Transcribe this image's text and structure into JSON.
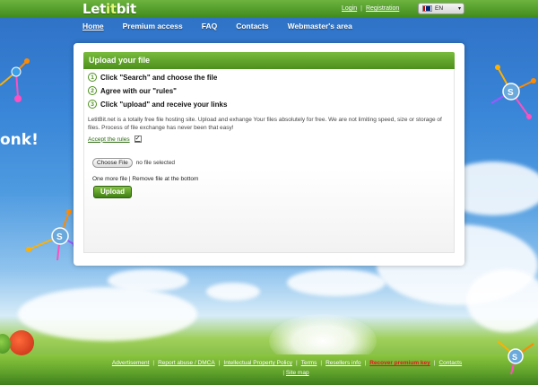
{
  "header": {
    "logo": {
      "part1": "Let",
      "part2": "it",
      "part3": "bit"
    },
    "login": "Login",
    "registration": "Registration",
    "language": "EN"
  },
  "nav": [
    "Home",
    "Premium access",
    "FAQ",
    "Contacts",
    "Webmaster's area"
  ],
  "panel": {
    "title": "Upload your file",
    "steps": [
      {
        "num": "1",
        "text": "Click \"Search\" and choose the file"
      },
      {
        "num": "2",
        "text": "Agree with our \"rules\""
      },
      {
        "num": "3",
        "text": "Click \"upload\" and receive your links"
      }
    ],
    "description": "LetitBit.net is a totally free file hosting site. Upload and exhange Your files absolutely for free. We are not limiting speed, size or storage of files. Process of file exchange has never been that easy!",
    "accept_rules": "Accept the rules",
    "accept_checked": "✓",
    "choose_file": "Choose File",
    "no_file": "no file selected",
    "one_more_file": "One more file",
    "remove_file": "Remove file at the bottom",
    "upload_button": "Upload"
  },
  "side_text": "onk!",
  "footer": {
    "links": [
      "Advertisement",
      "Report abuse / DMCA",
      "Intellectual Property Policy",
      "Terms",
      "Resellers info",
      "Recover premium key",
      "Contacts"
    ],
    "site_map": "Site map"
  },
  "colors": {
    "brand_green": "#4d8f1d",
    "warn_red": "#e21b1b"
  }
}
